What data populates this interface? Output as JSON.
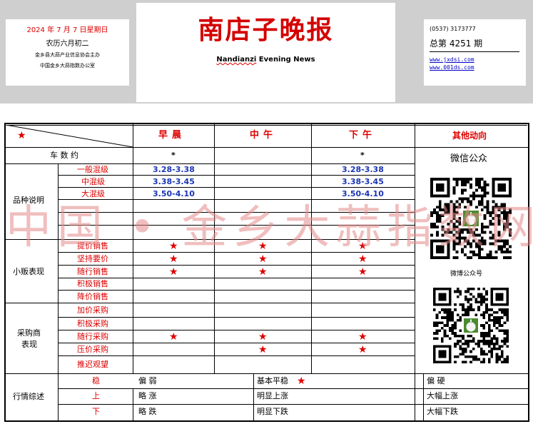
{
  "masthead": {
    "date": "2024 年 7 月 7 日星期日",
    "lunar": "农历六月初二",
    "sponsor": "金乡县大蒜产业信息协会主办",
    "office": "中国金乡大蒜指数办公室",
    "title": "南店子晚报",
    "subtitle_underlined": "Nandianzi",
    "subtitle_rest": " Evening News",
    "phone": "(0537) 3173777",
    "issue": "总第 4251 期",
    "link1": "www.jxdsi.com",
    "link2": "www.001ds.com"
  },
  "watermark": "中国 • 金乡大蒜指数网",
  "table": {
    "corner_star": "★",
    "col_morning": "早晨",
    "col_noon": "中午",
    "col_afternoon": "下午",
    "col_other": "其他动向",
    "wechat_label": "微信公众",
    "weibo_label": "微博公众号",
    "vehicles_label": "车 数 约",
    "vehicles_morning": "*",
    "vehicles_afternoon": "*",
    "variety_group": "品种说明",
    "varieties": [
      {
        "label": "一般混级",
        "morning": "3.28-3.38",
        "afternoon": "3.28-3.38"
      },
      {
        "label": "中混级",
        "morning": "3.38-3.45",
        "afternoon": "3.38-3.45"
      },
      {
        "label": "大混级",
        "morning": "3.50-4.10",
        "afternoon": "3.50-4.10"
      }
    ],
    "vendor_group": "小贩表现",
    "vendor_rows": [
      {
        "label": "提价销售",
        "morning": "★",
        "noon": "★",
        "afternoon": "★"
      },
      {
        "label": "坚持要价",
        "morning": "★",
        "noon": "★",
        "afternoon": "★"
      },
      {
        "label": "随行销售",
        "morning": "★",
        "noon": "★",
        "afternoon": "★"
      },
      {
        "label": "积极销售",
        "morning": "",
        "noon": "",
        "afternoon": ""
      },
      {
        "label": "降价销售",
        "morning": "",
        "noon": "",
        "afternoon": ""
      }
    ],
    "buyer_group_1": "采购商",
    "buyer_group_2": "表现",
    "buyer_rows": [
      {
        "label": "加价采购",
        "morning": "",
        "noon": "",
        "afternoon": ""
      },
      {
        "label": "积极采购",
        "morning": "",
        "noon": "",
        "afternoon": ""
      },
      {
        "label": "随行采购",
        "morning": "★",
        "noon": "★",
        "afternoon": "★"
      },
      {
        "label": "压价采购",
        "morning": "",
        "noon": "★",
        "afternoon": "★"
      },
      {
        "label": "推迟观望",
        "morning": "",
        "noon": "",
        "afternoon": ""
      }
    ],
    "summary_group": "行情综述",
    "summary_rows": [
      {
        "label": "稳",
        "c1": "偏 弱",
        "c2": "基本平稳",
        "c2_star": "★",
        "c3": "偏 硬"
      },
      {
        "label": "上",
        "c1": "略 涨",
        "c2": "明显上涨",
        "c2_star": "",
        "c3": "大幅上涨"
      },
      {
        "label": "下",
        "c1": "略 跌",
        "c2": "明显下跌",
        "c2_star": "",
        "c3": "大幅下跌"
      }
    ]
  }
}
